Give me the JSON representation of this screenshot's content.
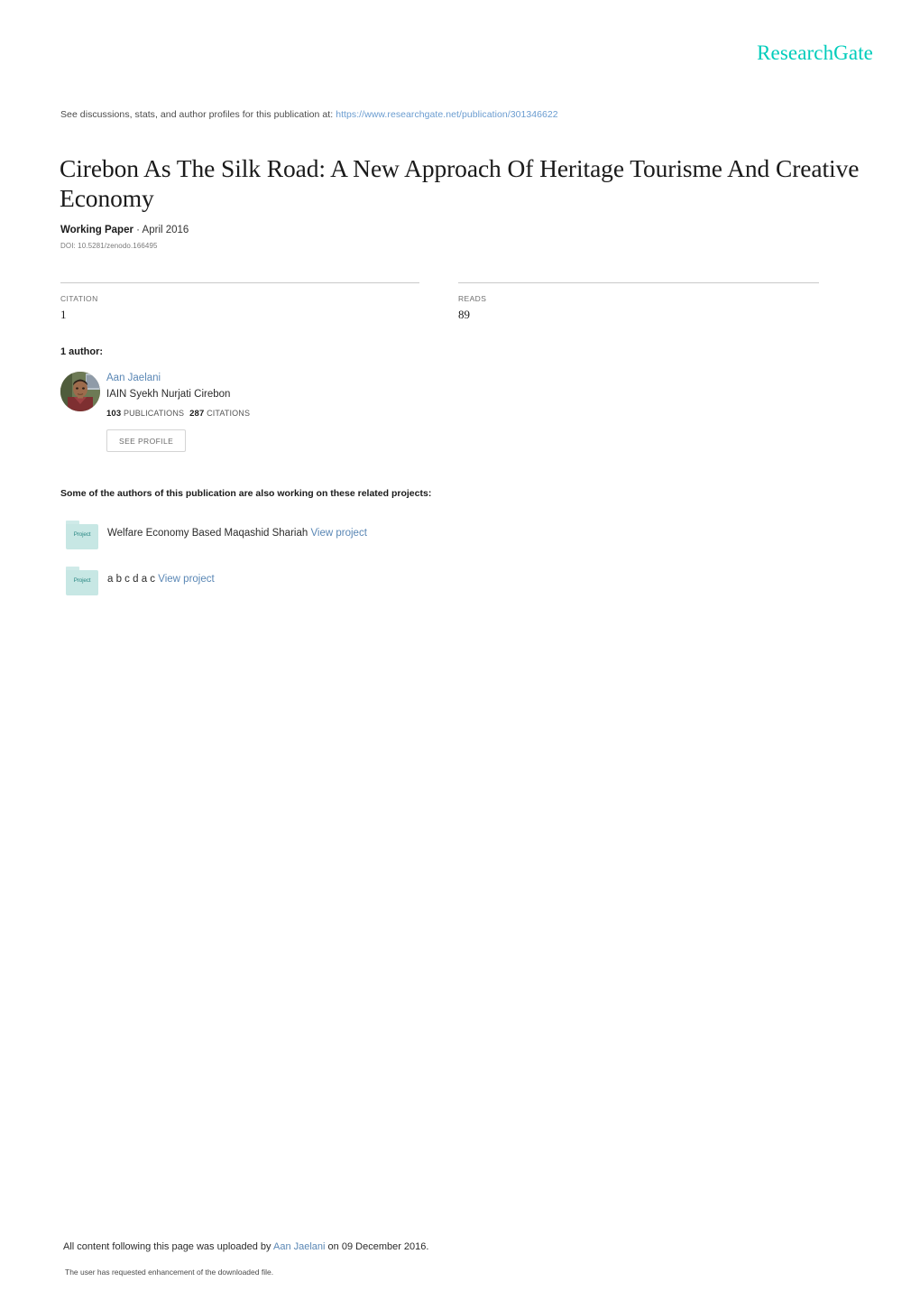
{
  "brand": {
    "logo_text": "ResearchGate",
    "accent_color": "#00ccbb"
  },
  "discussions": {
    "prefix": "See discussions, stats, and author profiles for this publication at: ",
    "url": "https://www.researchgate.net/publication/301346622"
  },
  "publication": {
    "title": "Cirebon As The Silk Road: A New Approach Of Heritage Tourisme And Creative Economy",
    "type": "Working Paper",
    "date_separator": " · ",
    "date": "April 2016",
    "doi": "DOI: 10.5281/zenodo.166495"
  },
  "stats": [
    {
      "label": "CITATION",
      "value": "1"
    },
    {
      "label": "READS",
      "value": "89"
    }
  ],
  "authors_section": {
    "heading": "1 author:",
    "author": {
      "name": "Aan Jaelani",
      "affiliation": "IAIN Syekh Nurjati Cirebon",
      "publications_count": "103",
      "publications_unit": "PUBLICATIONS",
      "citations_count": "287",
      "citations_unit": "CITATIONS",
      "see_profile_label": "SEE PROFILE"
    }
  },
  "projects_section": {
    "heading": "Some of the authors of this publication are also working on these related projects:",
    "icon_label": "Project",
    "view_link_label": "View project",
    "items": [
      {
        "title": "Welfare Economy Based Maqashid Shariah"
      },
      {
        "title": "a b c d a c"
      }
    ]
  },
  "footer": {
    "upload_prefix": "All content following this page was uploaded by ",
    "uploader_name": "Aan Jaelani",
    "upload_suffix": " on 09 December 2016.",
    "enhancement_note": "The user has requested enhancement of the downloaded file."
  }
}
